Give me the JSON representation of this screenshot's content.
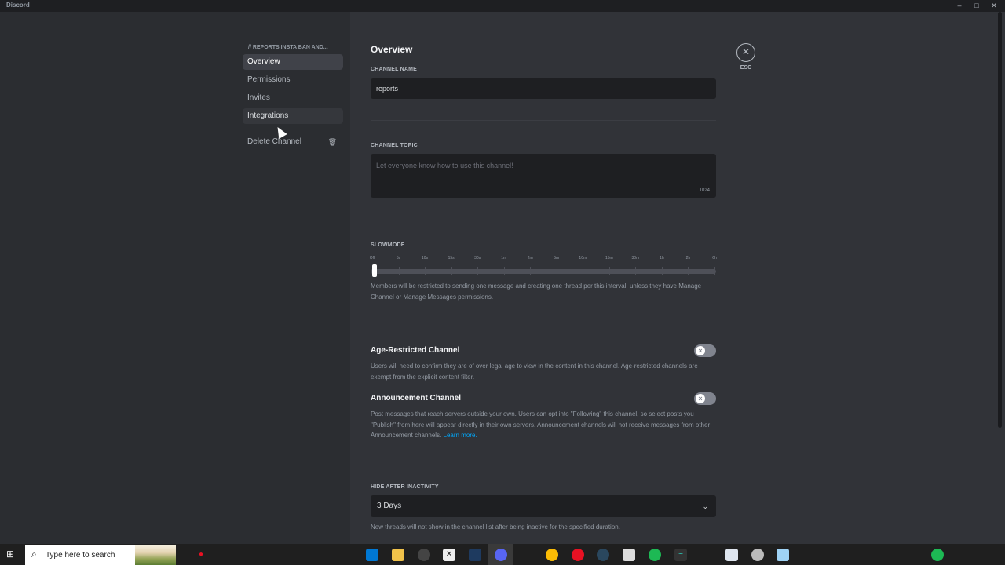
{
  "window": {
    "title": "Discord"
  },
  "sidebar": {
    "header": "// REPORTS INSTA BAN AND...",
    "items": [
      {
        "label": "Overview",
        "state": "selected"
      },
      {
        "label": "Permissions",
        "state": ""
      },
      {
        "label": "Invites",
        "state": ""
      },
      {
        "label": "Integrations",
        "state": "hover"
      }
    ],
    "delete_label": "Delete Channel"
  },
  "main": {
    "title": "Overview",
    "channel_name": {
      "label": "CHANNEL NAME",
      "value": "reports"
    },
    "channel_topic": {
      "label": "CHANNEL TOPIC",
      "placeholder": "Let everyone know how to use this channel!",
      "counter": "1024"
    },
    "slowmode": {
      "label": "SLOWMODE",
      "ticks": [
        "Off",
        "5s",
        "10s",
        "15s",
        "30s",
        "1m",
        "2m",
        "5m",
        "10m",
        "15m",
        "30m",
        "1h",
        "2h",
        "6h"
      ],
      "selected_index": 0,
      "description": "Members will be restricted to sending one message and creating one thread per this interval, unless they have Manage Channel or Manage Messages permissions."
    },
    "age_restricted": {
      "title": "Age-Restricted Channel",
      "enabled": false,
      "description": "Users will need to confirm they are of over legal age to view in the content in this channel. Age-restricted channels are exempt from the explicit content filter."
    },
    "announcement": {
      "title": "Announcement Channel",
      "enabled": false,
      "description": "Post messages that reach servers outside your own. Users can opt into \"Following\" this channel, so select posts you \"Publish\" from here will appear directly in their own servers. Announcement channels will not receive messages from other Announcement channels.",
      "link": "Learn more."
    },
    "hide_after_inactivity": {
      "label": "HIDE AFTER INACTIVITY",
      "value": "3 Days",
      "description": "New threads will not show in the channel list after being inactive for the specified duration."
    }
  },
  "close": {
    "label": "ESC"
  },
  "taskbar": {
    "search_placeholder": "Type here to search"
  },
  "colors": {
    "accent_link": "#00a8fc",
    "background": "#313338",
    "sidebar": "#2b2d31"
  }
}
